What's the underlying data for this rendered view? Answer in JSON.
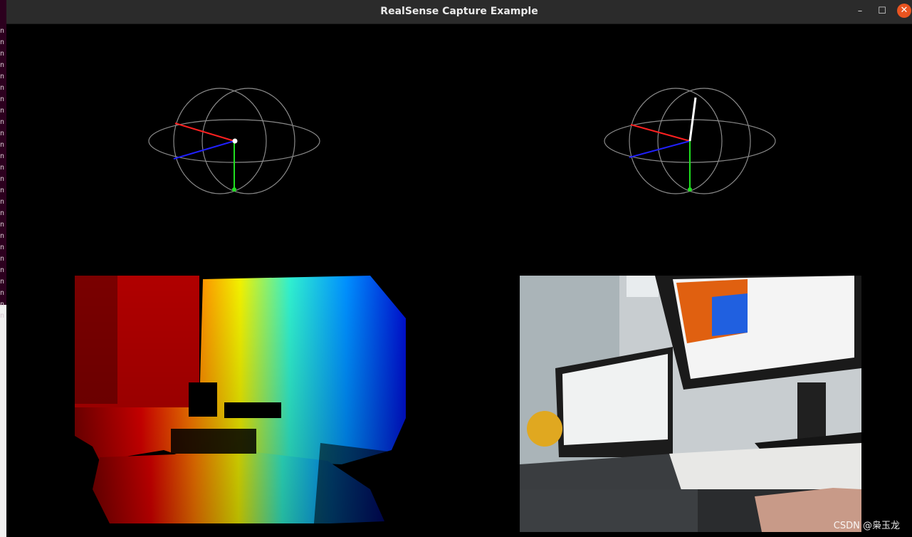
{
  "window": {
    "title": "RealSense Capture Example",
    "minimize_glyph": "–",
    "maximize_glyph": "☐",
    "close_glyph": "✕"
  },
  "terminal_strip": {
    "glyph": "n"
  },
  "streams": {
    "accel": {
      "icon": "gyro-sphere-icon"
    },
    "gyro": {
      "icon": "gyro-sphere-icon"
    },
    "depth": {
      "icon": "depth-colormap"
    },
    "color": {
      "icon": "camera-image"
    }
  },
  "colors": {
    "axis_x": "#ff2020",
    "axis_y": "#20e020",
    "axis_z": "#2020ff",
    "sphere": "#8a8a8a",
    "vector": "#ffffff",
    "close_button": "#e95420"
  },
  "watermark": "CSDN @枭玉龙"
}
